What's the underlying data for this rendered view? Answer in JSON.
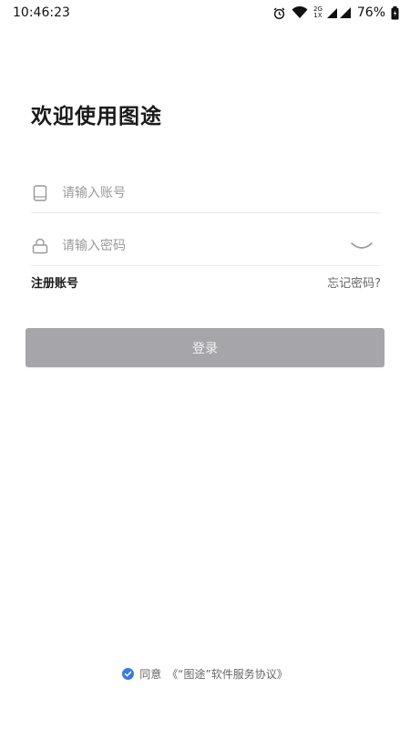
{
  "status_bar": {
    "time": "10:46:23",
    "network_top": "2G",
    "network_bottom": "1X",
    "battery": "76%",
    "icons": [
      "alarm-icon",
      "wifi-icon",
      "signal-icon",
      "battery-icon"
    ]
  },
  "title": "欢迎使用图途",
  "account": {
    "placeholder": "请输入账号",
    "value": "",
    "icon": "phone-icon"
  },
  "password": {
    "placeholder": "请输入密码",
    "value": "",
    "icon": "lock-icon",
    "toggle_icon": "eye-closed-icon"
  },
  "links": {
    "register": "注册账号",
    "forgot": "忘记密码?"
  },
  "login_button": "登录",
  "agreement": {
    "prefix": "同意",
    "link": "《“图途”软件服务协议》",
    "checked": true
  },
  "colors": {
    "accent": "#3b7be0",
    "button_disabled": "#a6a6aa",
    "divider": "#e9e9ef"
  }
}
